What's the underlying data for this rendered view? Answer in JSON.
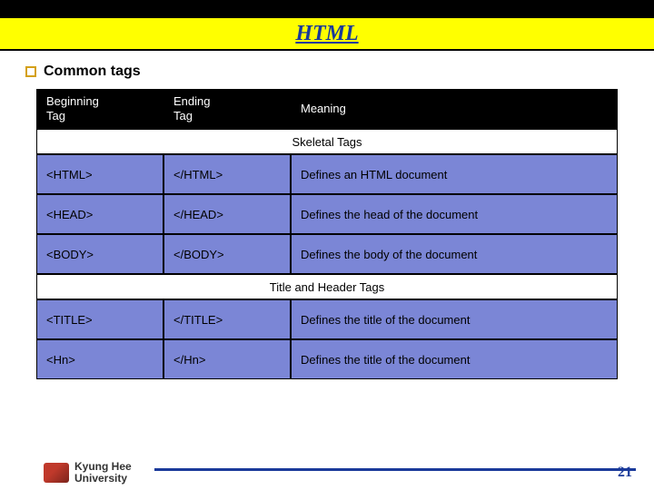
{
  "title": "HTML",
  "bullet_label": "Common tags",
  "headers": {
    "begin": "Beginning\nTag",
    "end": "Ending\nTag",
    "meaning": "Meaning"
  },
  "sections": [
    {
      "title": "Skeletal Tags",
      "rows": [
        {
          "begin": "<HTML>",
          "end": "</HTML>",
          "meaning": "Defines an HTML document"
        },
        {
          "begin": "<HEAD>",
          "end": "</HEAD>",
          "meaning": "Defines the head of the document"
        },
        {
          "begin": "<BODY>",
          "end": "</BODY>",
          "meaning": "Defines the body of the document"
        }
      ]
    },
    {
      "title": "Title and Header Tags",
      "rows": [
        {
          "begin": "<TITLE>",
          "end": "</TITLE>",
          "meaning": "Defines the title of the document"
        },
        {
          "begin": "<Hn>",
          "end": "</Hn>",
          "meaning": "Defines the title of the document"
        }
      ]
    }
  ],
  "footer": {
    "university_line1": "Kyung Hee",
    "university_line2": "University",
    "page": "21"
  }
}
